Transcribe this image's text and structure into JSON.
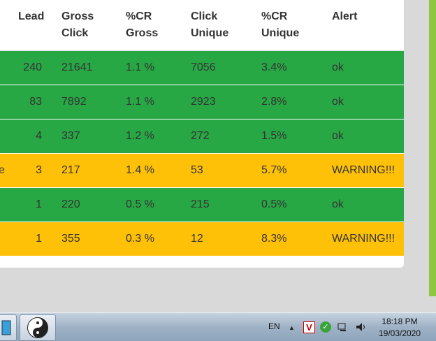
{
  "table": {
    "headers": [
      {
        "l1": "",
        "l2": "Lead"
      },
      {
        "l1": "Gross",
        "l2": "Click"
      },
      {
        "l1": "%CR",
        "l2": "Gross"
      },
      {
        "l1": "Click",
        "l2": "Unique"
      },
      {
        "l1": "%CR",
        "l2": "Unique"
      },
      {
        "l1": "",
        "l2": "Alert"
      }
    ],
    "rows": [
      {
        "lead": "240",
        "gross": "21641",
        "crg": "1.1 %",
        "cu": "7056",
        "cru": "3.4%",
        "alert": "ok",
        "status": "ok"
      },
      {
        "lead": "83",
        "gross": "7892",
        "crg": "1.1 %",
        "cu": "2923",
        "cru": "2.8%",
        "alert": "ok",
        "status": "ok"
      },
      {
        "lead": "4",
        "gross": "337",
        "crg": "1.2 %",
        "cu": "272",
        "cru": "1.5%",
        "alert": "ok",
        "status": "ok"
      },
      {
        "lead": "3",
        "gross": "217",
        "crg": "1.4 %",
        "cu": "53",
        "cru": "5.7%",
        "alert": "WARNING!!!",
        "status": "warn",
        "cut": "e"
      },
      {
        "lead": "1",
        "gross": "220",
        "crg": "0.5 %",
        "cu": "215",
        "cru": "0.5%",
        "alert": "ok",
        "status": "ok"
      },
      {
        "lead": "1",
        "gross": "355",
        "crg": "0.3 %",
        "cu": "12",
        "cru": "8.3%",
        "alert": "WARNING!!!",
        "status": "warn"
      }
    ]
  },
  "taskbar": {
    "language": "EN",
    "time": "18:18 PM",
    "date": "19/03/2020",
    "icons": [
      "show-hidden-icon",
      "antivirus-v-icon",
      "shield-check-icon",
      "network-icon",
      "volume-icon"
    ]
  },
  "colors": {
    "ok": "#28a745",
    "warn": "#ffc107"
  }
}
